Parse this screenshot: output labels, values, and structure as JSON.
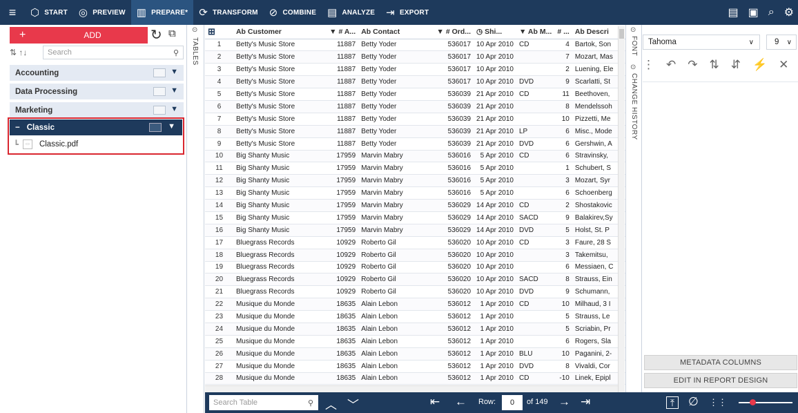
{
  "topbar": {
    "menu_icon": "hamburger-icon",
    "nav": [
      {
        "label": "START",
        "icon": "start-cube-icon"
      },
      {
        "label": "PREVIEW",
        "icon": "eye-icon"
      },
      {
        "label": "PREPARE*",
        "icon": "prepare-icon",
        "active": true
      },
      {
        "label": "TRANSFORM",
        "icon": "transform-icon"
      },
      {
        "label": "COMBINE",
        "icon": "combine-icon"
      },
      {
        "label": "ANALYZE",
        "icon": "analyze-icon"
      },
      {
        "label": "EXPORT",
        "icon": "export-icon"
      }
    ]
  },
  "left": {
    "add_label": "ADD",
    "search_placeholder": "Search",
    "groups": [
      "Accounting",
      "Data Processing",
      "Marketing"
    ],
    "selected_group": "Classic",
    "selected_group_toggle": "−",
    "file": "Classic.pdf"
  },
  "tables_tab": "TABLES",
  "grid": {
    "headers": [
      "",
      "Ab Customer",
      "▼ # A...",
      "Ab Contact",
      "▼ # Ord...",
      "◷ Shi...",
      "▼ Ab M...",
      "# ...",
      "Ab Descri"
    ],
    "rows": [
      [
        "1",
        "Betty's Music Store",
        "11887",
        "Betty Yoder",
        "536017",
        "10 Apr 2010",
        "CD",
        "4",
        "Bartok, Son"
      ],
      [
        "2",
        "Betty's Music Store",
        "11887",
        "Betty Yoder",
        "536017",
        "10 Apr 2010",
        "",
        "7",
        "Mozart, Mas"
      ],
      [
        "3",
        "Betty's Music Store",
        "11887",
        "Betty Yoder",
        "536017",
        "10 Apr 2010",
        "",
        "2",
        "Luening, Ele"
      ],
      [
        "4",
        "Betty's Music Store",
        "11887",
        "Betty Yoder",
        "536017",
        "10 Apr 2010",
        "DVD",
        "9",
        "Scarlatti, St"
      ],
      [
        "5",
        "Betty's Music Store",
        "11887",
        "Betty Yoder",
        "536039",
        "21 Apr 2010",
        "CD",
        "11",
        "Beethoven,"
      ],
      [
        "6",
        "Betty's Music Store",
        "11887",
        "Betty Yoder",
        "536039",
        "21 Apr 2010",
        "",
        "8",
        "Mendelssoh"
      ],
      [
        "7",
        "Betty's Music Store",
        "11887",
        "Betty Yoder",
        "536039",
        "21 Apr 2010",
        "",
        "10",
        "Pizzetti, Me"
      ],
      [
        "8",
        "Betty's Music Store",
        "11887",
        "Betty Yoder",
        "536039",
        "21 Apr 2010",
        "LP",
        "6",
        "Misc., Mode"
      ],
      [
        "9",
        "Betty's Music Store",
        "11887",
        "Betty Yoder",
        "536039",
        "21 Apr 2010",
        "DVD",
        "6",
        "Gershwin, A"
      ],
      [
        "10",
        "Big Shanty Music",
        "17959",
        "Marvin Mabry",
        "536016",
        "5 Apr 2010",
        "CD",
        "6",
        "Stravinsky,"
      ],
      [
        "11",
        "Big Shanty Music",
        "17959",
        "Marvin Mabry",
        "536016",
        "5 Apr 2010",
        "",
        "1",
        "Schubert, S"
      ],
      [
        "12",
        "Big Shanty Music",
        "17959",
        "Marvin Mabry",
        "536016",
        "5 Apr 2010",
        "",
        "3",
        "Mozart, Syr"
      ],
      [
        "13",
        "Big Shanty Music",
        "17959",
        "Marvin Mabry",
        "536016",
        "5 Apr 2010",
        "",
        "6",
        "Schoenberg"
      ],
      [
        "14",
        "Big Shanty Music",
        "17959",
        "Marvin Mabry",
        "536029",
        "14 Apr 2010",
        "CD",
        "2",
        "Shostakovic"
      ],
      [
        "15",
        "Big Shanty Music",
        "17959",
        "Marvin Mabry",
        "536029",
        "14 Apr 2010",
        "SACD",
        "9",
        "Balakirev,Sy"
      ],
      [
        "16",
        "Big Shanty Music",
        "17959",
        "Marvin Mabry",
        "536029",
        "14 Apr 2010",
        "DVD",
        "5",
        "Holst, St. P"
      ],
      [
        "17",
        "Bluegrass Records",
        "10929",
        "Roberto Gil",
        "536020",
        "10 Apr 2010",
        "CD",
        "3",
        "Faure, 28 S"
      ],
      [
        "18",
        "Bluegrass Records",
        "10929",
        "Roberto Gil",
        "536020",
        "10 Apr 2010",
        "",
        "3",
        "Takemitsu,"
      ],
      [
        "19",
        "Bluegrass Records",
        "10929",
        "Roberto Gil",
        "536020",
        "10 Apr 2010",
        "",
        "6",
        "Messiaen, C"
      ],
      [
        "20",
        "Bluegrass Records",
        "10929",
        "Roberto Gil",
        "536020",
        "10 Apr 2010",
        "SACD",
        "8",
        "Strauss, Ein"
      ],
      [
        "21",
        "Bluegrass Records",
        "10929",
        "Roberto Gil",
        "536020",
        "10 Apr 2010",
        "DVD",
        "9",
        "Schumann,"
      ],
      [
        "22",
        "Musique du Monde",
        "18635",
        "Alain Lebon",
        "536012",
        "1 Apr 2010",
        "CD",
        "10",
        "Milhaud, 3 I"
      ],
      [
        "23",
        "Musique du Monde",
        "18635",
        "Alain Lebon",
        "536012",
        "1 Apr 2010",
        "",
        "5",
        "Strauss, Le"
      ],
      [
        "24",
        "Musique du Monde",
        "18635",
        "Alain Lebon",
        "536012",
        "1 Apr 2010",
        "",
        "5",
        "Scriabin, Pr"
      ],
      [
        "25",
        "Musique du Monde",
        "18635",
        "Alain Lebon",
        "536012",
        "1 Apr 2010",
        "",
        "6",
        "Rogers, Sla"
      ],
      [
        "26",
        "Musique du Monde",
        "18635",
        "Alain Lebon",
        "536012",
        "1 Apr 2010",
        "BLU",
        "10",
        "Paganini, 2-"
      ],
      [
        "27",
        "Musique du Monde",
        "18635",
        "Alain Lebon",
        "536012",
        "1 Apr 2010",
        "DVD",
        "8",
        "Vivaldi, Cor"
      ],
      [
        "28",
        "Musique du Monde",
        "18635",
        "Alain Lebon",
        "536012",
        "1 Apr 2010",
        "CD",
        "-10",
        "Linek, Epipl"
      ]
    ]
  },
  "side_tabs": {
    "font": "FONT",
    "history": "CHANGE HISTORY"
  },
  "right": {
    "font_name": "Tahoma",
    "font_size": "9",
    "metadata_button": "METADATA COLUMNS",
    "report_button": "EDIT IN REPORT DESIGN"
  },
  "bottom": {
    "search_placeholder": "Search Table",
    "row_label": "Row:",
    "row_value": "0",
    "of_label": "of 149"
  },
  "colors": {
    "navbar": "#1e3a5c",
    "accent": "#e8394b",
    "selection_border": "#d9262f"
  }
}
